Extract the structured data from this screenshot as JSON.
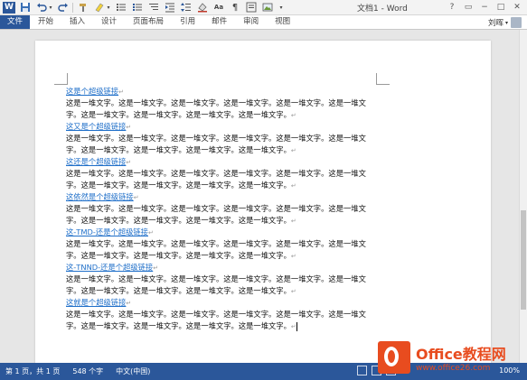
{
  "titlebar": {
    "app_logo": "W",
    "title": "文档1 - Word",
    "controls": [
      "?",
      "▭",
      "−",
      "□",
      "✕"
    ]
  },
  "ribbon": {
    "tabs": [
      "文件",
      "开始",
      "插入",
      "设计",
      "页面布局",
      "引用",
      "邮件",
      "审阅",
      "视图"
    ],
    "user": "刘晖"
  },
  "document": {
    "paragraphs": [
      {
        "link": "这是个超级链接",
        "lines": [
          "这是一堆文字。这是一堆文字。这是一堆文字。这是一堆文字。这是一堆文字。这是一堆文",
          "字。这是一堆文字。这是一堆文字。这是一堆文字。这是一堆文字。"
        ]
      },
      {
        "link": "这又是个超级链接",
        "lines": [
          "这是一堆文字。这是一堆文字。这是一堆文字。这是一堆文字。这是一堆文字。这是一堆文",
          "字。这是一堆文字。这是一堆文字。这是一堆文字。这是一堆文字。"
        ]
      },
      {
        "link": "这还是个超级链接",
        "lines": [
          "这是一堆文字。这是一堆文字。这是一堆文字。这是一堆文字。这是一堆文字。这是一堆文",
          "字。这是一堆文字。这是一堆文字。这是一堆文字。这是一堆文字。"
        ]
      },
      {
        "link": "这依然是个超级链接",
        "lines": [
          "这是一堆文字。这是一堆文字。这是一堆文字。这是一堆文字。这是一堆文字。这是一堆文",
          "字。这是一堆文字。这是一堆文字。这是一堆文字。这是一堆文字。"
        ]
      },
      {
        "link": "这-TMD-还是个超级链接",
        "lines": [
          "这是一堆文字。这是一堆文字。这是一堆文字。这是一堆文字。这是一堆文字。这是一堆文",
          "字。这是一堆文字。这是一堆文字。这是一堆文字。这是一堆文字。"
        ]
      },
      {
        "link": "这-TNND-还是个超级链接",
        "lines": [
          "这是一堆文字。这是一堆文字。这是一堆文字。这是一堆文字。这是一堆文字。这是一堆文",
          "字。这是一堆文字。这是一堆文字。这是一堆文字。这是一堆文字。"
        ]
      },
      {
        "link": "这就是个超级链接",
        "lines": [
          "这是一堆文字。这是一堆文字。这是一堆文字。这是一堆文字。这是一堆文字。这是一堆文",
          "字。这是一堆文字。这是一堆文字。这是一堆文字。这是一堆文字。"
        ]
      }
    ],
    "paragraph_mark": "↵"
  },
  "statusbar": {
    "page": "第 1 页，共 1 页",
    "words": "548 个字",
    "language": "中文(中国)",
    "zoom": "100%"
  },
  "watermark": {
    "title": "Office教程网",
    "url": "www.office26.com"
  },
  "colors": {
    "accent": "#2b579a",
    "link": "#1f6fc9",
    "watermark": "#e84c1f"
  }
}
